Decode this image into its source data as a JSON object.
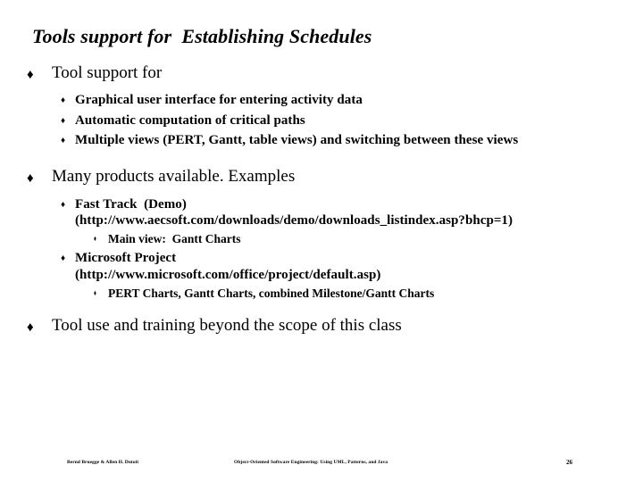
{
  "slide": {
    "title": "Tools support for  Establishing Schedules",
    "bullets": {
      "b1": "Tool support for",
      "b1_s1": "Graphical user interface for entering activity data",
      "b1_s2": "Automatic computation of critical paths",
      "b1_s3": "Multiple views (PERT, Gantt, table views) and switching between these views",
      "b2": "Many products available. Examples",
      "b2_s1": "Fast Track  (Demo)\n(http://www.aecsoft.com/downloads/demo/downloads_listindex.asp?bhcp=1)",
      "b2_s1_t1": "Main view:  Gantt Charts",
      "b2_s2": "Microsoft Project\n(http://www.microsoft.com/office/project/default.asp)",
      "b2_s2_t1": "PERT Charts, Gantt Charts, combined Milestone/Gantt Charts",
      "b3": "Tool use and training beyond the scope of this class"
    },
    "glyphs": {
      "level1": "♦",
      "level2": "♦",
      "level3": "♦"
    }
  },
  "footer": {
    "authors": "Bernd Bruegge & Allen H. Dutoit",
    "book": "Object-Oriented Software Engineering: Using UML, Patterns, and Java",
    "page": "26"
  },
  "colors": {
    "background": "#ffffff",
    "text": "#000000"
  }
}
